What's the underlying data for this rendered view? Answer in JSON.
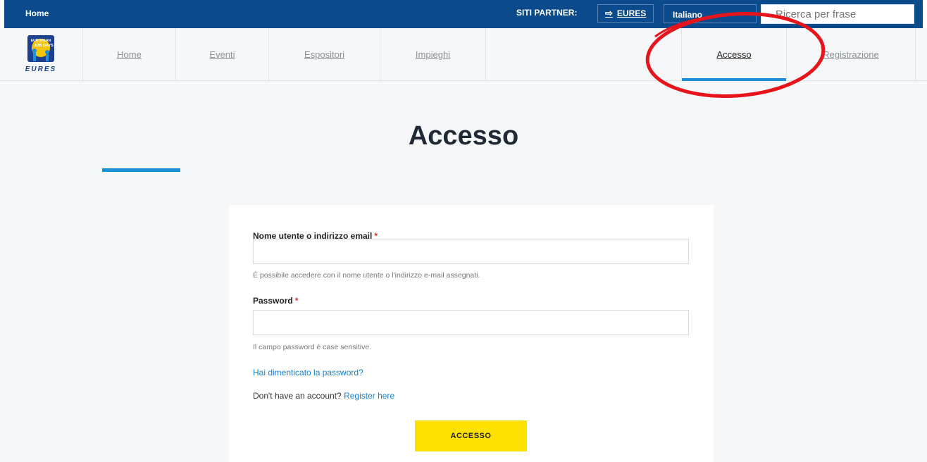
{
  "topbar": {
    "home_label": "Home",
    "partner_label": "SITI PARTNER:",
    "partner_link": "EURES",
    "language": "Italiano",
    "search_placeholder": "Ricerca per frase"
  },
  "logo": {
    "top_text": "EUROPEAN",
    "mid_text": "JOB DAYS",
    "bottom_text": "EURES"
  },
  "nav": {
    "items": [
      {
        "label": "Home"
      },
      {
        "label": "Eventi"
      },
      {
        "label": "Espositori"
      },
      {
        "label": "Impieghi"
      },
      {
        "label": "Accesso"
      },
      {
        "label": "Registrazione"
      }
    ],
    "active_item": "Accesso"
  },
  "page": {
    "title": "Accesso"
  },
  "form": {
    "username_label": "Nome utente o indirizzo email",
    "username_value": "",
    "username_help": "È possibile accedere con il nome utente o l'indirizzo e-mail assegnati.",
    "password_label": "Password",
    "password_value": "",
    "password_help": "Il campo password è case sensitive.",
    "required_marker": "*",
    "forgot_link": "Hai dimenticato la password?",
    "no_account_text": "Don't have an account?",
    "register_link": "Register here",
    "submit_label": "ACCESSO"
  },
  "colors": {
    "topbar": "#0b4a8b",
    "accent": "#1a91d6",
    "submit": "#ffe100",
    "required": "#d9312b",
    "annotation": "#e8141c"
  }
}
